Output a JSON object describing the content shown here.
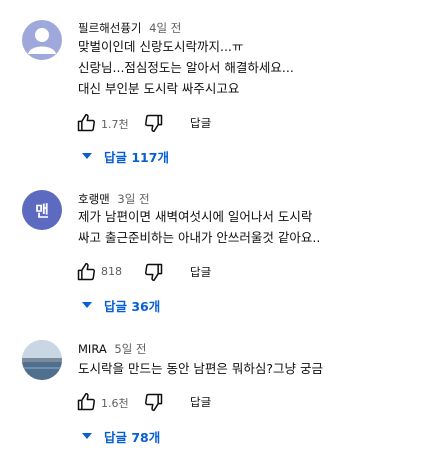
{
  "comments": [
    {
      "author": "필르해선퓽기",
      "time": "4일 전",
      "avatar_text": "",
      "lines": [
        "맞벌이인데 신랑도시락까지...ㅠ",
        "신랑님...점심정도는 알아서 해결하세요...",
        "대신 부인분 도시락 싸주시고요"
      ],
      "likes": "1.7천",
      "reply_label": "답글",
      "replies_label": "답글 117개"
    },
    {
      "author": "호랭맨",
      "time": "3일 전",
      "avatar_text": "맨",
      "lines": [
        "제가 남편이면 새벽여섯시에 일어나서 도시락",
        "싸고 출근준비하는 아내가 안쓰러울것 같아요.."
      ],
      "likes": "818",
      "reply_label": "답글",
      "replies_label": "답글 36개"
    },
    {
      "author": "MIRA",
      "time": "5일 전",
      "avatar_text": "",
      "lines": [
        "도시락을 만드는 동안 남편은 뭐하심?그냥 궁금"
      ],
      "likes": "1.6천",
      "reply_label": "답글",
      "replies_label": "답글 78개"
    }
  ],
  "icons": {
    "like": "thumb-up-icon",
    "dislike": "thumb-down-icon",
    "expand": "caret-down-icon"
  },
  "colors": {
    "link_blue": "#065fd4",
    "secondary_text": "#606060",
    "default_avatar": "#9fa8da",
    "letter_avatar": "#5c6bc0"
  }
}
